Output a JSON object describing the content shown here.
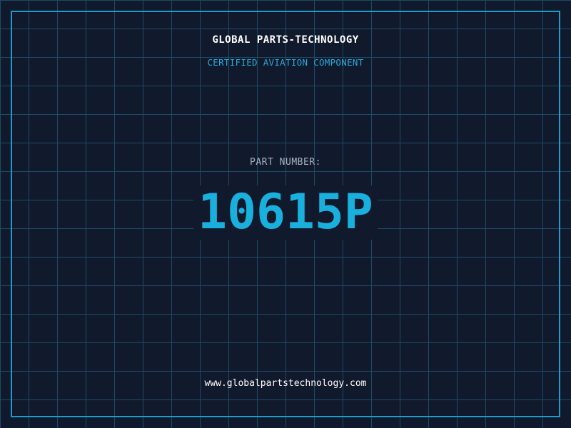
{
  "header": {
    "brand": "GLOBAL PARTS-TECHNOLOGY",
    "tagline": "CERTIFIED AVIATION COMPONENT"
  },
  "part": {
    "label": "PART NUMBER:",
    "number": "10615P"
  },
  "footer": {
    "website": "www.globalpartstechnology.com"
  },
  "colors": {
    "background": "#111a2c",
    "grid": "#1e4a66",
    "accent": "#1ab0de",
    "frame": "#1a9fcc"
  }
}
